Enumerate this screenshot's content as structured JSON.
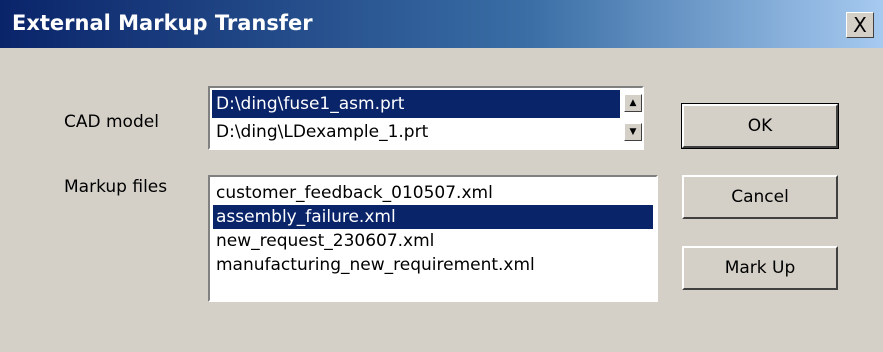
{
  "window": {
    "title": "External Markup Transfer",
    "close_symbol": "X"
  },
  "cad_model": {
    "label": "CAD model",
    "items": [
      {
        "text": "D:\\ding\\fuse1_asm.prt",
        "selected": true
      },
      {
        "text": "D:\\ding\\LDexample_1.prt",
        "selected": false
      }
    ],
    "scroll_up_icon": "up-arrow-icon",
    "scroll_down_icon": "down-arrow-icon"
  },
  "markup_files": {
    "label": "Markup files",
    "items": [
      {
        "text": "customer_feedback_010507.xml",
        "selected": false
      },
      {
        "text": "assembly_failure.xml",
        "selected": true
      },
      {
        "text": "new_request_230607.xml",
        "selected": false
      },
      {
        "text": "manufacturing_new_requirement.xml",
        "selected": false
      }
    ]
  },
  "buttons": {
    "ok": "OK",
    "cancel": "Cancel",
    "markup": "Mark Up"
  },
  "colors": {
    "title_bar_start": "#0a246a",
    "title_bar_end": "#a6caf0",
    "dialog_face": "#d4d0c8",
    "selection": "#0a246a"
  }
}
